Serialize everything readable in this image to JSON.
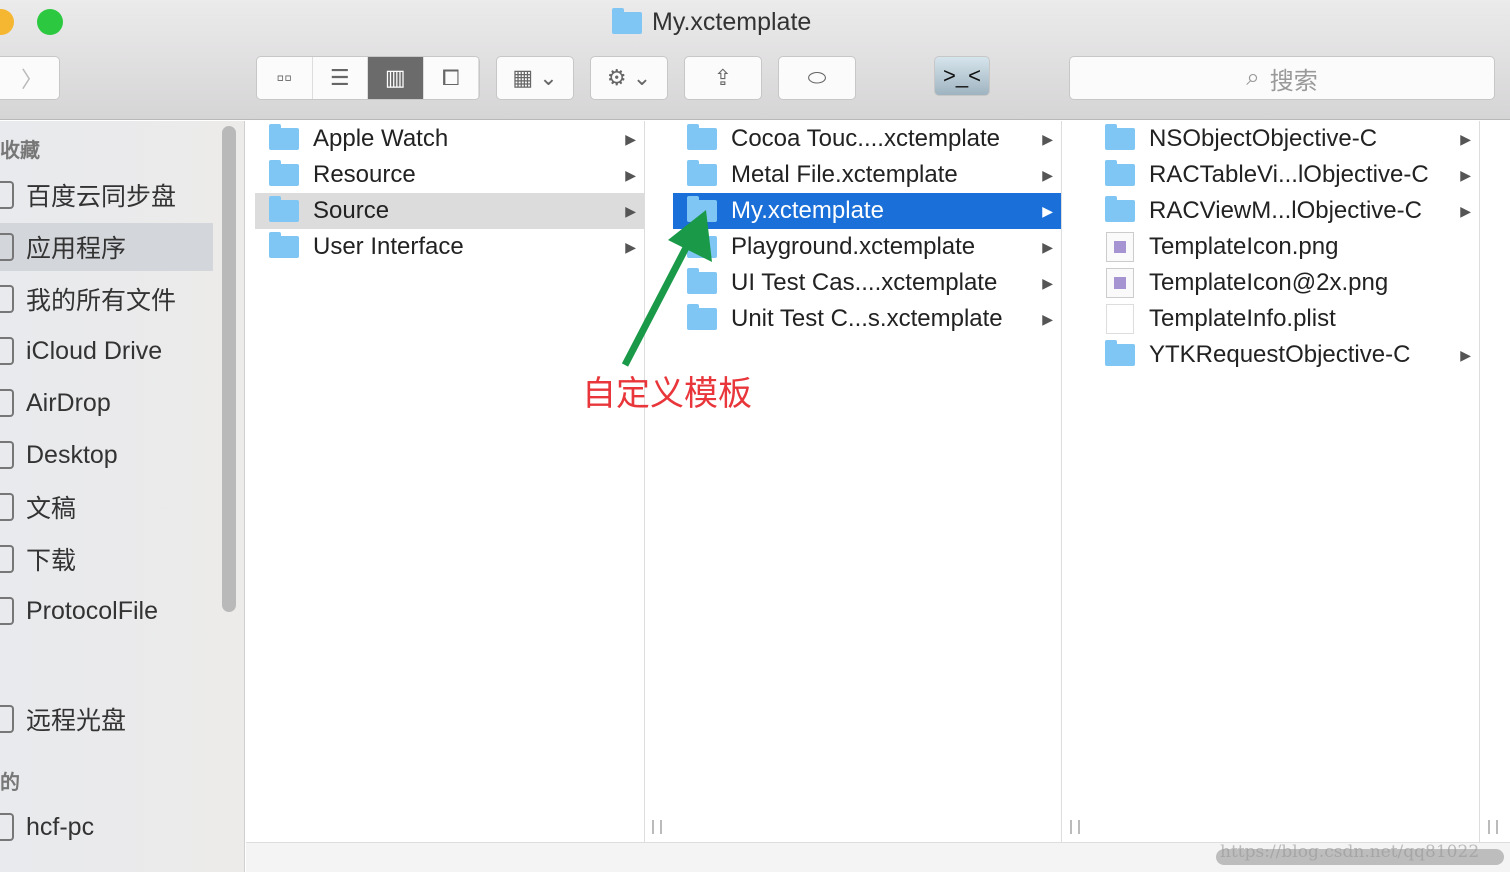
{
  "window": {
    "title": "My.xctemplate"
  },
  "toolbar": {
    "view_modes": [
      "icon-view",
      "list-view",
      "column-view",
      "cover-flow-view"
    ],
    "active_view": "column-view",
    "search_placeholder": "搜索"
  },
  "sidebar": {
    "sections": [
      {
        "header": "收藏",
        "items": [
          "百度云同步盘",
          "应用程序",
          "我的所有文件",
          "iCloud Drive",
          "AirDrop",
          "Desktop",
          "文稿",
          "下载",
          "ProtocolFile"
        ]
      },
      {
        "header": "",
        "items": [
          "远程光盘"
        ]
      },
      {
        "header": "的",
        "items": [
          "hcf-pc"
        ]
      }
    ],
    "selected": "应用程序"
  },
  "columns": [
    {
      "items": [
        {
          "name": "Apple Watch",
          "type": "folder"
        },
        {
          "name": "Resource",
          "type": "folder"
        },
        {
          "name": "Source",
          "type": "folder",
          "state": "selected"
        },
        {
          "name": "User Interface",
          "type": "folder"
        }
      ]
    },
    {
      "items": [
        {
          "name": "Cocoa Touc....xctemplate",
          "type": "folder"
        },
        {
          "name": "Metal File.xctemplate",
          "type": "folder"
        },
        {
          "name": "My.xctemplate",
          "type": "folder",
          "state": "active"
        },
        {
          "name": "Playground.xctemplate",
          "type": "folder"
        },
        {
          "name": "UI Test Cas....xctemplate",
          "type": "folder"
        },
        {
          "name": "Unit Test C...s.xctemplate",
          "type": "folder"
        }
      ]
    },
    {
      "items": [
        {
          "name": "NSObjectObjective-C",
          "type": "folder"
        },
        {
          "name": "RACTableVi...lObjective-C",
          "type": "folder"
        },
        {
          "name": "RACViewM...lObjective-C",
          "type": "folder"
        },
        {
          "name": "TemplateIcon.png",
          "type": "image"
        },
        {
          "name": "TemplateIcon@2x.png",
          "type": "image"
        },
        {
          "name": "TemplateInfo.plist",
          "type": "file"
        },
        {
          "name": "YTKRequestObjective-C",
          "type": "folder"
        }
      ]
    }
  ],
  "annotation": {
    "text": "自定义模板",
    "color": "#e8363b",
    "arrow_color": "#1a9a48"
  },
  "watermark": "https://blog.csdn.net/qq81022",
  "colors": {
    "selection": "#1a6fd8",
    "folder": "#7fc6f4"
  }
}
